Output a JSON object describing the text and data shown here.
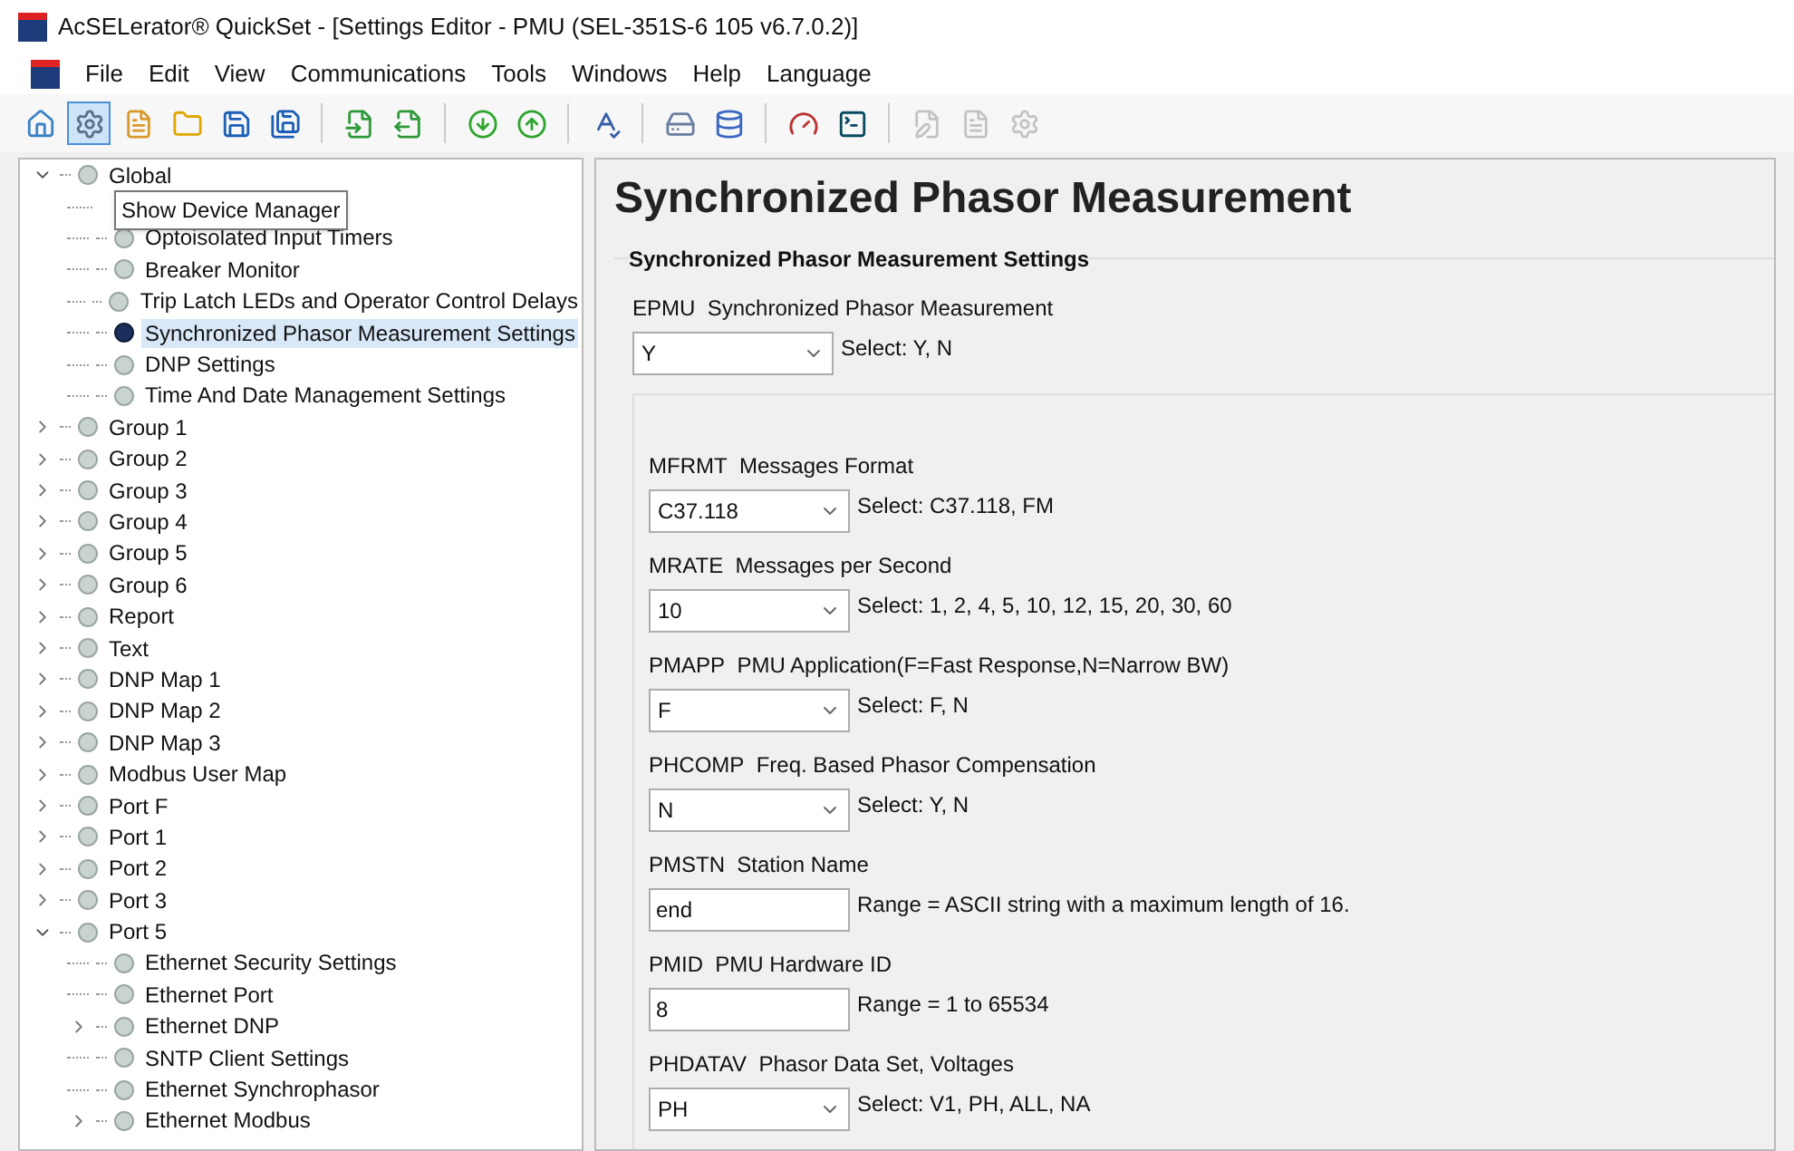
{
  "window": {
    "title": "AcSELerator® QuickSet - [Settings Editor - PMU (SEL-351S-6 105 v6.7.0.2)]"
  },
  "menu": [
    "File",
    "Edit",
    "View",
    "Communications",
    "Tools",
    "Windows",
    "Help",
    "Language"
  ],
  "toolbar": [
    {
      "kind": "home",
      "selected": false,
      "disabled": false
    },
    {
      "kind": "device",
      "selected": true,
      "disabled": false
    },
    {
      "kind": "new",
      "selected": false,
      "disabled": false
    },
    {
      "kind": "open",
      "selected": false,
      "disabled": false
    },
    {
      "kind": "save",
      "selected": false,
      "disabled": false
    },
    {
      "kind": "saveall",
      "selected": false,
      "disabled": false
    },
    {
      "kind": "sep"
    },
    {
      "kind": "import",
      "selected": false,
      "disabled": false
    },
    {
      "kind": "export",
      "selected": false,
      "disabled": false
    },
    {
      "kind": "sep"
    },
    {
      "kind": "down",
      "selected": false,
      "disabled": false
    },
    {
      "kind": "up",
      "selected": false,
      "disabled": false
    },
    {
      "kind": "sep"
    },
    {
      "kind": "spell",
      "selected": false,
      "disabled": false
    },
    {
      "kind": "sep"
    },
    {
      "kind": "driver",
      "selected": false,
      "disabled": false
    },
    {
      "kind": "database",
      "selected": false,
      "disabled": false
    },
    {
      "kind": "sep"
    },
    {
      "kind": "meter",
      "selected": false,
      "disabled": false
    },
    {
      "kind": "terminal",
      "selected": false,
      "disabled": false
    },
    {
      "kind": "sep"
    },
    {
      "kind": "edit",
      "selected": false,
      "disabled": true
    },
    {
      "kind": "report",
      "selected": false,
      "disabled": true
    },
    {
      "kind": "gear",
      "selected": false,
      "disabled": true
    }
  ],
  "tooltip": "Show Device Manager",
  "tree": [
    {
      "label": "Global",
      "expanded": true,
      "selected": false,
      "children": [
        {
          "kind": "covered"
        },
        {
          "label": "Optoisolated Input Timers",
          "selected": false
        },
        {
          "label": "Breaker Monitor",
          "selected": false
        },
        {
          "label": "Trip Latch LEDs and Operator Control Delays",
          "selected": false
        },
        {
          "label": "Synchronized Phasor Measurement Settings",
          "selected": true
        },
        {
          "label": "DNP Settings",
          "selected": false
        },
        {
          "label": "Time And Date Management Settings",
          "selected": false
        }
      ]
    },
    {
      "label": "Group 1",
      "expanded": false,
      "selected": false
    },
    {
      "label": "Group 2",
      "expanded": false,
      "selected": false
    },
    {
      "label": "Group 3",
      "expanded": false,
      "selected": false
    },
    {
      "label": "Group 4",
      "expanded": false,
      "selected": false
    },
    {
      "label": "Group 5",
      "expanded": false,
      "selected": false
    },
    {
      "label": "Group 6",
      "expanded": false,
      "selected": false
    },
    {
      "label": "Report",
      "expanded": false,
      "selected": false
    },
    {
      "label": "Text",
      "expanded": false,
      "selected": false
    },
    {
      "label": "DNP Map 1",
      "expanded": false,
      "selected": false
    },
    {
      "label": "DNP Map 2",
      "expanded": false,
      "selected": false
    },
    {
      "label": "DNP Map 3",
      "expanded": false,
      "selected": false
    },
    {
      "label": "Modbus User Map",
      "expanded": false,
      "selected": false
    },
    {
      "label": "Port F",
      "expanded": false,
      "selected": false
    },
    {
      "label": "Port 1",
      "expanded": false,
      "selected": false
    },
    {
      "label": "Port 2",
      "expanded": false,
      "selected": false
    },
    {
      "label": "Port 3",
      "expanded": false,
      "selected": false
    },
    {
      "label": "Port 5",
      "expanded": true,
      "selected": false,
      "children": [
        {
          "label": "Ethernet Security Settings",
          "selected": false
        },
        {
          "label": "Ethernet Port",
          "selected": false
        },
        {
          "label": "Ethernet DNP",
          "expanded": false,
          "selected": false
        },
        {
          "label": "SNTP Client Settings",
          "selected": false
        },
        {
          "label": "Ethernet Synchrophasor",
          "selected": false
        },
        {
          "label": "Ethernet Modbus",
          "expanded": false,
          "selected": false
        }
      ]
    }
  ],
  "page": {
    "title": "Synchronized Phasor Measurement",
    "section": "Synchronized Phasor Measurement Settings",
    "main_field": {
      "code": "EPMU",
      "label": "Synchronized Phasor Measurement",
      "kind": "select",
      "value": "Y",
      "hint": "Select: Y, N"
    },
    "fields": [
      {
        "code": "MFRMT",
        "label": "Messages Format",
        "kind": "select",
        "value": "C37.118",
        "hint": "Select: C37.118, FM"
      },
      {
        "code": "MRATE",
        "label": "Messages per Second",
        "kind": "select",
        "value": "10",
        "hint": "Select: 1, 2, 4, 5, 10, 12, 15, 20, 30, 60"
      },
      {
        "code": "PMAPP",
        "label": "PMU Application(F=Fast Response,N=Narrow BW)",
        "kind": "select",
        "value": "F",
        "hint": "Select: F, N"
      },
      {
        "code": "PHCOMP",
        "label": "Freq. Based Phasor Compensation",
        "kind": "select",
        "value": "N",
        "hint": "Select: Y, N"
      },
      {
        "code": "PMSTN",
        "label": "Station Name",
        "kind": "text",
        "value": "end",
        "hint": "Range = ASCII string with a maximum length of 16."
      },
      {
        "code": "PMID",
        "label": "PMU Hardware ID",
        "kind": "text",
        "value": "8",
        "hint": "Range = 1 to 65534"
      },
      {
        "code": "PHDATAV",
        "label": "Phasor Data Set, Voltages",
        "kind": "select",
        "value": "PH",
        "hint": "Select: V1, PH, ALL, NA"
      }
    ]
  }
}
